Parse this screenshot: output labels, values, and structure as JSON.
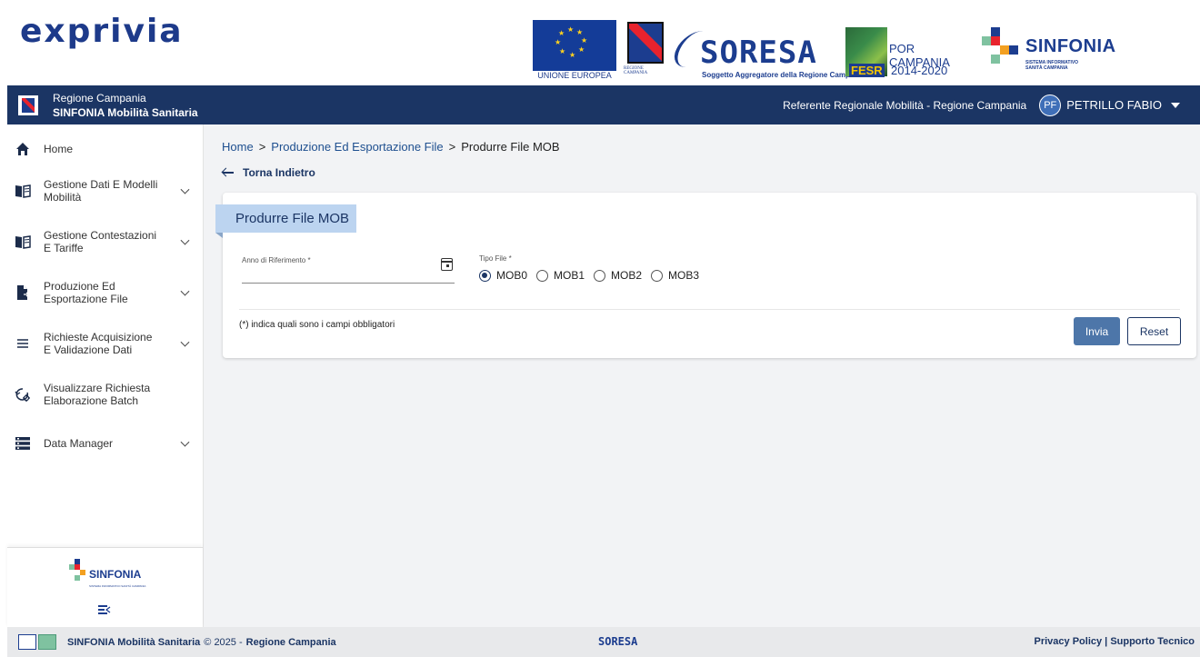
{
  "brand": {
    "name": "exprivia"
  },
  "partners": {
    "eu_caption": "UNIONE EUROPEA",
    "rc_caption": "REGIONE CAMPANIA",
    "soresa_word": "SORESA",
    "soresa_caption": "Soggetto Aggregatore della Regione Campania",
    "por_title": "POR CAMPANIA",
    "por_fesr": "FESR",
    "por_years": "2014-2020",
    "sinfonia_name": "SINFONIA",
    "sinfonia_sub_1": "SISTEMA INFORMATIVO",
    "sinfonia_sub_2": "SANITÀ CAMPANIA"
  },
  "header": {
    "region": "Regione Campania",
    "app": "SINFONIA Mobilità Sanitaria",
    "role": "Referente Regionale Mobilità - Regione Campania",
    "avatar_initials": "PF",
    "user": "PETRILLO FABIO"
  },
  "sidebar": {
    "items": [
      {
        "label": "Home",
        "icon": "home-icon"
      },
      {
        "label": "Gestione Dati E Modelli Mobilità",
        "icon": "book-icon"
      },
      {
        "label": "Gestione Contestazioni E Tariffe",
        "icon": "book-icon"
      },
      {
        "label": "Produzione Ed Esportazione File",
        "icon": "file-export-icon"
      },
      {
        "label": "Richieste Acquisizione E Validazione Dati",
        "icon": "list-icon"
      },
      {
        "label": "Visualizzare Richiesta Elaborazione Batch",
        "icon": "history-settings-icon"
      },
      {
        "label": "Data Manager",
        "icon": "storage-icon"
      }
    ],
    "footer_logo": "SINFONIA",
    "footer_logo_sub": "SISTEMA INFORMATIVO SANITÀ CAMPANIA"
  },
  "breadcrumb": {
    "home": "Home",
    "sep": ">",
    "parent": "Produzione Ed Esportazione File",
    "current": "Produrre File MOB"
  },
  "back_label": "Torna Indietro",
  "form": {
    "title": "Produrre File MOB",
    "anno_label": "Anno di Riferimento *",
    "anno_value": "",
    "tipo_label": "Tipo File *",
    "tipo_options": [
      "MOB0",
      "MOB1",
      "MOB2",
      "MOB3"
    ],
    "tipo_selected": "MOB0",
    "required_note": "(*) indica quali sono i campi obbligatori",
    "submit_label": "Invia",
    "reset_label": "Reset"
  },
  "footer": {
    "app": "SINFONIA Mobilità Sanitaria",
    "copyright": "© 2025 -",
    "region": "Regione Campania",
    "soresa": "SORESA",
    "privacy": "Privacy Policy",
    "link_sep": "|",
    "support": "Supporto Tecnico"
  },
  "colors": {
    "header_bg": "#1b3564",
    "accent": "#4d76a9",
    "card_title_bg": "#bcd4f0",
    "page_bg": "#f2f3f5"
  }
}
